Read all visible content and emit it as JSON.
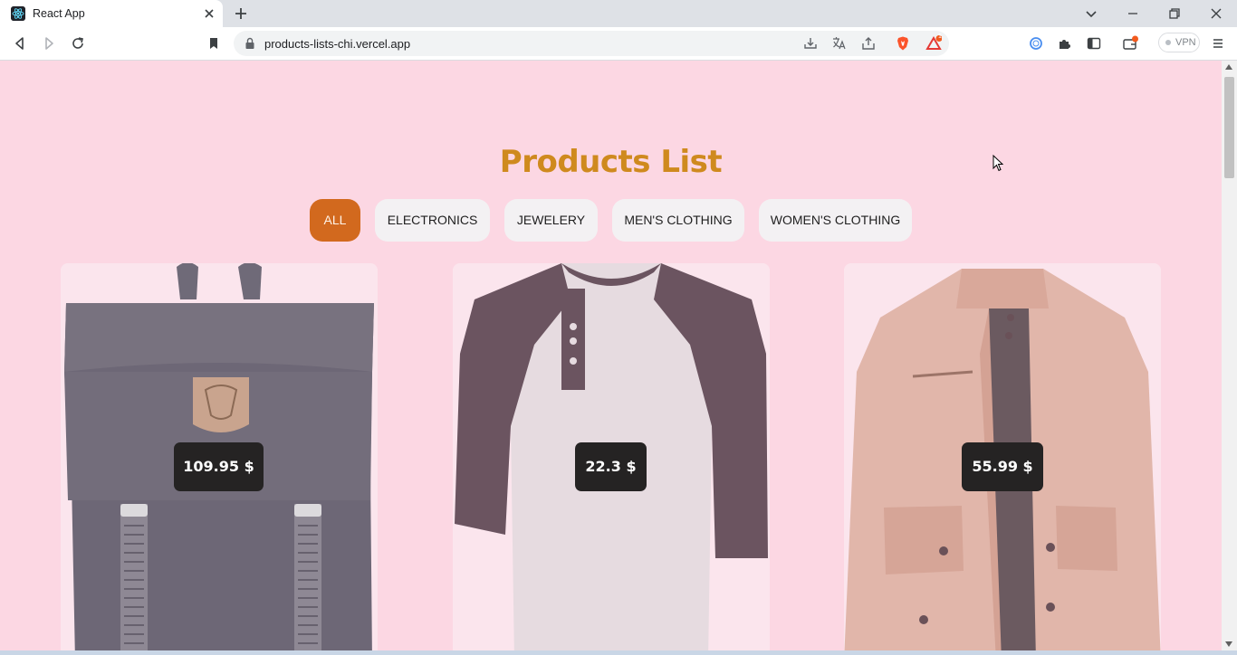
{
  "browser": {
    "tab_title": "React App",
    "url": "products-lists-chi.vercel.app",
    "vpn_label": "VPN",
    "notification_count": "1"
  },
  "page": {
    "title": "Products List",
    "filters": [
      {
        "label": "ALL",
        "active": true
      },
      {
        "label": "ELECTRONICS",
        "active": false
      },
      {
        "label": "JEWELERY",
        "active": false
      },
      {
        "label": "MEN'S CLOTHING",
        "active": false
      },
      {
        "label": "WOMEN'S CLOTHING",
        "active": false
      }
    ],
    "products": [
      {
        "price": "109.95 $",
        "image": "backpack"
      },
      {
        "price": "22.3 $",
        "image": "raglan-tshirt"
      },
      {
        "price": "55.99 $",
        "image": "jacket"
      }
    ]
  },
  "colors": {
    "page_background": "#fcd7e3",
    "title": "#cf8a1e",
    "active_filter": "#d2691e",
    "inactive_filter": "#f3f1f3",
    "price_badge": "#252323"
  }
}
